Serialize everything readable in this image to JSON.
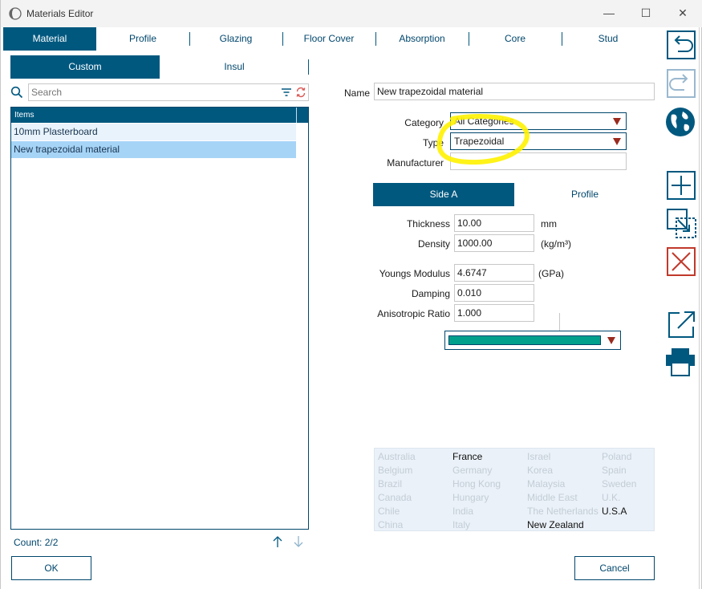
{
  "window": {
    "title": "Materials Editor",
    "minimize_glyph": "—",
    "maximize_glyph": "☐",
    "close_glyph": "✕"
  },
  "main_tabs": [
    {
      "label": "Material",
      "active": true
    },
    {
      "label": "Profile",
      "active": false
    },
    {
      "label": "Glazing",
      "active": false
    },
    {
      "label": "Floor Cover",
      "active": false
    },
    {
      "label": "Absorption",
      "active": false
    },
    {
      "label": "Core",
      "active": false
    },
    {
      "label": "Stud",
      "active": false
    }
  ],
  "sub_tabs": [
    {
      "label": "Custom",
      "active": true
    },
    {
      "label": "Insul",
      "active": false
    }
  ],
  "search": {
    "placeholder": "Search",
    "value": ""
  },
  "list": {
    "header": "Items",
    "items": [
      {
        "label": "10mm Plasterboard",
        "selected": false
      },
      {
        "label": "New trapezoidal material",
        "selected": true
      }
    ],
    "count_text": "Count: 2/2"
  },
  "buttons": {
    "ok": "OK",
    "cancel": "Cancel"
  },
  "form": {
    "name_label": "Name",
    "name_value": "New trapezoidal material",
    "category_label": "Category",
    "category_value": "All Categories",
    "type_label": "Type",
    "type_value": "Trapezoidal",
    "manufacturer_label": "Manufacturer",
    "manufacturer_value": ""
  },
  "side_tabs": [
    {
      "label": "Side A",
      "active": true
    },
    {
      "label": "Profile",
      "active": false
    }
  ],
  "properties": {
    "thickness_label": "Thickness",
    "thickness_value": "10.00",
    "thickness_unit": "mm",
    "density_label": "Density",
    "density_value": "1000.00",
    "density_unit": "(kg/m³)",
    "youngs_label": "Youngs Modulus",
    "youngs_value": "4.6747",
    "youngs_unit": "(GPa)",
    "damping_label": "Damping",
    "damping_value": "0.010",
    "aniso_label": "Anisotropic Ratio",
    "aniso_value": "1.000"
  },
  "color_picker": {
    "color": "#00a08c"
  },
  "countries": {
    "col1": [
      {
        "name": "Australia",
        "on": false
      },
      {
        "name": "Belgium",
        "on": false
      },
      {
        "name": "Brazil",
        "on": false
      },
      {
        "name": "Canada",
        "on": false
      },
      {
        "name": "Chile",
        "on": false
      },
      {
        "name": "China",
        "on": false
      }
    ],
    "col2": [
      {
        "name": "France",
        "on": true
      },
      {
        "name": "Germany",
        "on": false
      },
      {
        "name": "Hong Kong",
        "on": false
      },
      {
        "name": "Hungary",
        "on": false
      },
      {
        "name": "India",
        "on": false
      },
      {
        "name": "Italy",
        "on": false
      }
    ],
    "col3": [
      {
        "name": "Israel",
        "on": false
      },
      {
        "name": "Korea",
        "on": false
      },
      {
        "name": "Malaysia",
        "on": false
      },
      {
        "name": "Middle East",
        "on": false
      },
      {
        "name": "The Netherlands",
        "on": false
      },
      {
        "name": "New Zealand",
        "on": true
      }
    ],
    "col4": [
      {
        "name": "Poland",
        "on": false
      },
      {
        "name": "Spain",
        "on": false
      },
      {
        "name": "Sweden",
        "on": false
      },
      {
        "name": "U.K.",
        "on": false
      },
      {
        "name": "U.S.A",
        "on": true
      }
    ]
  },
  "side_toolbar": [
    "undo-icon",
    "redo-icon",
    "globe-icon",
    "add-icon",
    "duplicate-icon",
    "delete-icon",
    "export-icon",
    "print-icon"
  ],
  "colors": {
    "accent": "#00587f",
    "highlight": "#fff200",
    "arrow": "#9a2a1e",
    "selected_row": "#a6d4f7",
    "alt_row": "#e8f3fc"
  }
}
